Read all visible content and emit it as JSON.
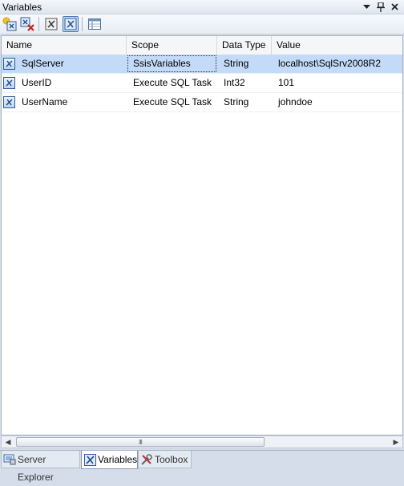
{
  "window": {
    "title": "Variables"
  },
  "icons": {
    "window_position": "chevron-down-icon",
    "auto_hide": "pin-icon",
    "close": "close-icon"
  },
  "toolbar": {
    "buttons": [
      {
        "icon": "add-variable-icon"
      },
      {
        "icon": "delete-variable-icon"
      },
      {
        "icon": "show-system-variables-icon"
      },
      {
        "icon": "show-all-variables-icon",
        "active": true
      },
      {
        "icon": "choose-columns-icon"
      }
    ]
  },
  "grid": {
    "columns": [
      "Name",
      "Scope",
      "Data Type",
      "Value"
    ],
    "rows": [
      {
        "name": "SqlServer",
        "scope": "SsisVariables",
        "type": "String",
        "value": "localhost\\SqlSrv2008R2",
        "selected": true
      },
      {
        "name": "UserID",
        "scope": "Execute SQL Task",
        "type": "Int32",
        "value": "101"
      },
      {
        "name": "UserName",
        "scope": "Execute SQL Task",
        "type": "String",
        "value": "johndoe"
      }
    ]
  },
  "scrollbar": {
    "grip": "III"
  },
  "tabs": [
    {
      "label": "Server Explorer",
      "icon": "server-explorer-icon"
    },
    {
      "label": "Variables",
      "icon": "variables-icon",
      "active": true
    },
    {
      "label": "Toolbox",
      "icon": "toolbox-icon"
    }
  ],
  "colors": {
    "selection": "#c3daf8",
    "panel": "#d4dde9",
    "icon_blue": "#2e5c9e"
  }
}
